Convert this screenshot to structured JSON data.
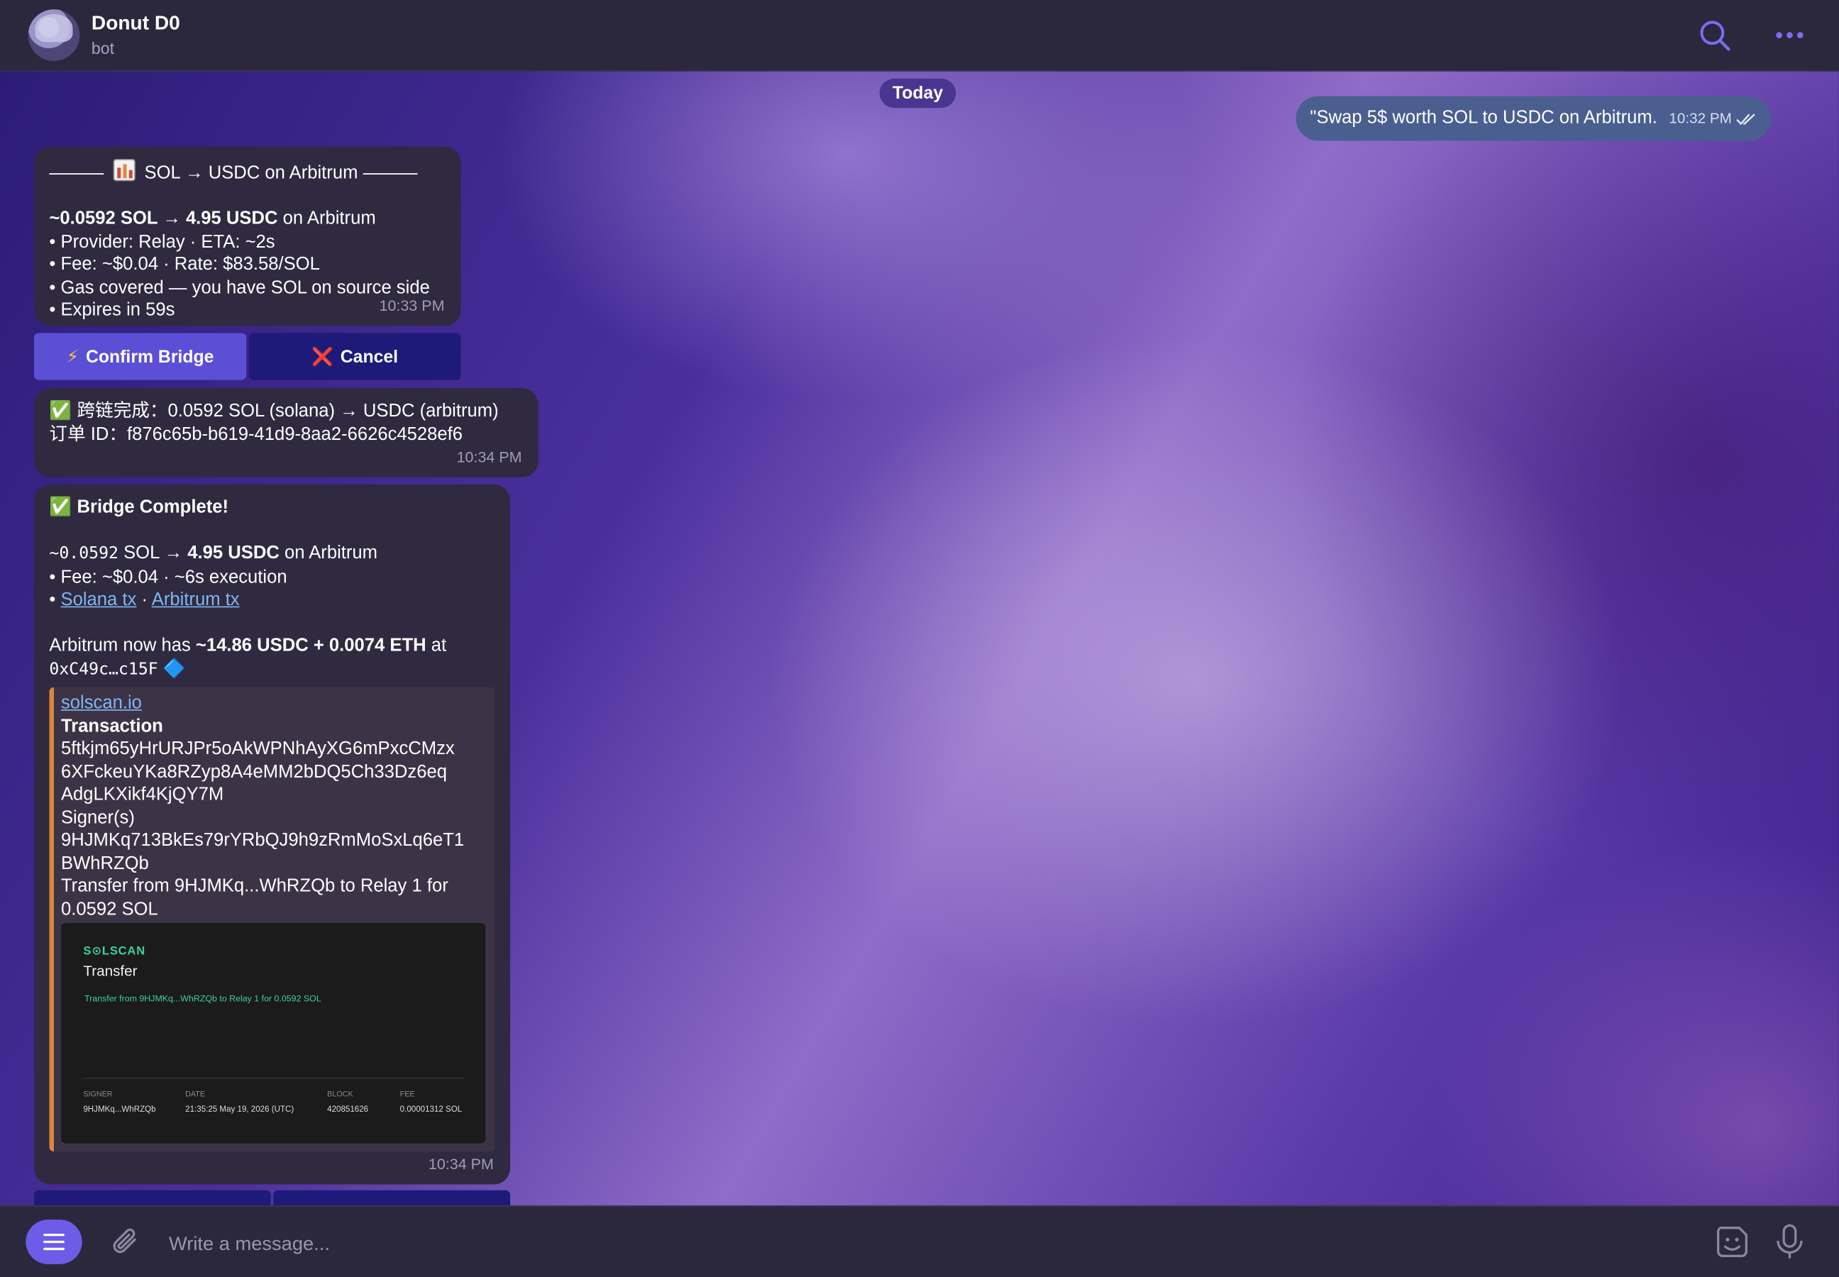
{
  "header": {
    "title": "Donut D0",
    "subtitle": "bot"
  },
  "chat": {
    "date_chip": "Today",
    "outgoing": {
      "text": "\"Swap 5$ worth SOL to USDC on Arbitrum.",
      "time": "10:32 PM"
    },
    "quote": {
      "header_left": "———",
      "header_title": "SOL → USDC on Arbitrum",
      "header_right": "———",
      "amount_bold": "~0.0592 SOL → 4.95 USDC",
      "amount_rest": " on Arbitrum",
      "lines": [
        "• Provider: Relay · ETA: ~2s",
        "• Fee: ~$0.04 · Rate: $83.58/SOL",
        "• Gas covered — you have SOL on source side",
        "• Expires in 59s"
      ],
      "time": "10:33 PM"
    },
    "buttons": {
      "confirm_icon": "⚡",
      "confirm": "Confirm Bridge",
      "cancel_icon": "❌",
      "cancel": "Cancel"
    },
    "cn_message": {
      "line1": "✅ 跨链完成：0.0592 SOL (solana) → USDC (arbitrum)",
      "line2": "订单 ID：f876c65b-b619-41d9-8aa2-6626c4528ef6",
      "time": "10:34 PM"
    },
    "complete": {
      "check": "✅",
      "title": "Bridge Complete!",
      "amount_mono": "~0.0592",
      "amount_sol": " SOL → ",
      "amount_usdc": "4.95 USDC",
      "amount_rest": " on Arbitrum",
      "fee_line": "• Fee: ~$0.04 · ~6s execution",
      "tx_bullet": "• ",
      "tx_solana": "Solana tx",
      "tx_sep": " · ",
      "tx_arbitrum": "Arbitrum tx",
      "balance_prefix": "Arbitrum now has ",
      "balance_bold": "~14.86 USDC + 0.0074 ETH",
      "balance_suffix": " at",
      "address": "0xC49c…c15F",
      "diamond": "🔷",
      "time": "10:34 PM",
      "preview": {
        "site": "solscan.io",
        "title": "Transaction",
        "hash_lines": [
          "5ftkjm65yHrURJPr5oAkWPNhAyXG6mPxcCMzx",
          "6XFckeuYKa8RZyp8A4eMM2bDQ5Ch33Dz6eq",
          "AdgLKXikf4KjQY7M"
        ],
        "signers_label": "Signer(s)",
        "signer_lines": [
          "9HJMKq713BkEs79rYRbQJ9h9zRmMoSxLq6eT1",
          "BWhRZQb"
        ],
        "transfer_lines": [
          "Transfer from 9HJMKq...WhRZQb to Relay 1 for",
          "0.0592 SOL"
        ],
        "image": {
          "logo": "S⊙LSCAN",
          "title": "Transfer",
          "desc": "Transfer from 9HJMKq...WhRZQb to Relay 1 for 0.0592 SOL",
          "columns": [
            {
              "head": "SIGNER",
              "value": "9HJMKq...WhRZQb"
            },
            {
              "head": "DATE",
              "value": "21:35:25 May 19, 2026 (UTC)"
            },
            {
              "head": "BLOCK",
              "value": "420851626"
            },
            {
              "head": "FEE",
              "value": "0.00001312 SOL"
            }
          ]
        }
      }
    }
  },
  "composer": {
    "placeholder": "Write a message..."
  },
  "colors": {
    "accent": "#6c5ce7",
    "confirm_button": "#5b4fd6",
    "cancel_button": "#1e1a7a",
    "link": "#7fb6f2",
    "preview_bar": "#d8873a"
  },
  "icons": {
    "search": "search-icon",
    "more": "more-icon",
    "menu": "menu-icon",
    "attach": "paperclip-icon",
    "sticker": "sticker-icon",
    "mic": "microphone-icon",
    "read": "double-check-icon"
  }
}
